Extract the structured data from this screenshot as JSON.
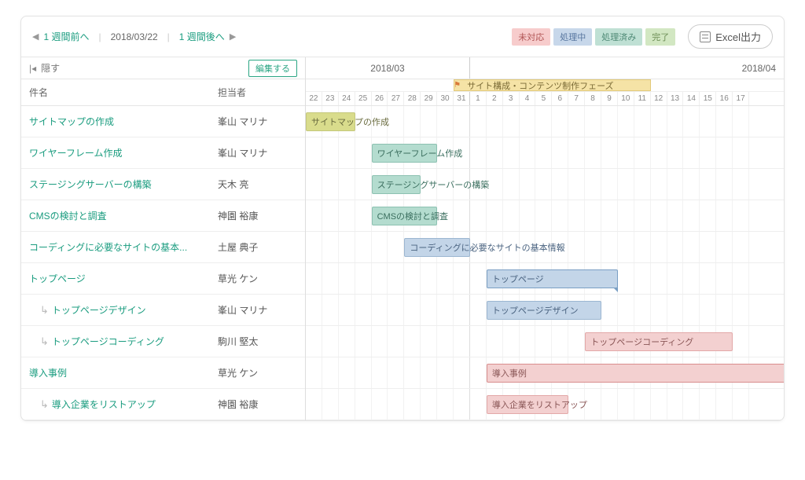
{
  "topbar": {
    "prev_label": "1 週間前へ",
    "date": "2018/03/22",
    "next_label": "1 週間後へ",
    "statuses": [
      {
        "label": "未対応",
        "cls": "chip-a"
      },
      {
        "label": "処理中",
        "cls": "chip-b"
      },
      {
        "label": "処理済み",
        "cls": "chip-c"
      },
      {
        "label": "完了",
        "cls": "chip-d"
      }
    ],
    "excel_label": "Excel出力"
  },
  "left": {
    "hide_label": "隠す",
    "edit_label": "編集する",
    "col_name": "件名",
    "col_assignee": "担当者"
  },
  "timeline": {
    "month1": "2018/03",
    "month2": "2018/04",
    "days": [
      "22",
      "23",
      "24",
      "25",
      "26",
      "27",
      "28",
      "29",
      "30",
      "31",
      "1",
      "2",
      "3",
      "4",
      "5",
      "6",
      "7",
      "8",
      "9",
      "10",
      "11",
      "12",
      "13",
      "14",
      "15",
      "16",
      "17"
    ],
    "month_sep_index": 9,
    "phase": {
      "label": "サイト構成・コンテンツ制作フェーズ",
      "start": 9,
      "len": 12
    }
  },
  "tasks": [
    {
      "name": "サイトマップの作成",
      "assignee": "峯山 マリナ",
      "indent": 0,
      "bar": {
        "label": "サイトマップの作成",
        "start": 0,
        "len": 3,
        "color": "olive"
      }
    },
    {
      "name": "ワイヤーフレーム作成",
      "assignee": "峯山 マリナ",
      "indent": 0,
      "bar": {
        "label": "ワイヤーフレーム作成",
        "start": 4,
        "len": 4,
        "color": "teal"
      }
    },
    {
      "name": "ステージングサーバーの構築",
      "assignee": "天木 亮",
      "indent": 0,
      "bar": {
        "label": "ステージングサーバーの構築",
        "start": 4,
        "len": 3,
        "color": "teal"
      }
    },
    {
      "name": "CMSの検討と調査",
      "assignee": "神園 裕康",
      "indent": 0,
      "bar": {
        "label": "CMSの検討と調査",
        "start": 4,
        "len": 4,
        "color": "teal"
      }
    },
    {
      "name": "コーディングに必要なサイトの基本...",
      "assignee": "土屋 典子",
      "indent": 0,
      "bar": {
        "label": "コーディングに必要なサイトの基本情報",
        "start": 6,
        "len": 4,
        "color": "blue"
      }
    },
    {
      "name": "トップページ",
      "assignee": "草光 ケン",
      "indent": 0,
      "bar": {
        "label": "トップページ",
        "start": 11,
        "len": 8,
        "color": "blue-header"
      }
    },
    {
      "name": "トップページデザイン",
      "assignee": "峯山 マリナ",
      "indent": 1,
      "bar": {
        "label": "トップページデザイン",
        "start": 11,
        "len": 7,
        "color": "blue"
      }
    },
    {
      "name": "トップページコーディング",
      "assignee": "駒川 堅太",
      "indent": 1,
      "bar": {
        "label": "トップページコーディング",
        "start": 17,
        "len": 9,
        "color": "pink"
      }
    },
    {
      "name": "導入事例",
      "assignee": "草光 ケン",
      "indent": 0,
      "bar": {
        "label": "導入事例",
        "start": 11,
        "len": 19,
        "color": "pink-header"
      }
    },
    {
      "name": "導入企業をリストアップ",
      "assignee": "神園 裕康",
      "indent": 1,
      "bar": {
        "label": "導入企業をリストアップ",
        "start": 11,
        "len": 5,
        "color": "pink"
      }
    }
  ],
  "chart_data": {
    "type": "gantt",
    "title": "",
    "x_unit": "day",
    "x_range": [
      "2018-03-22",
      "2018-04-17"
    ],
    "phase": {
      "name": "サイト構成・コンテンツ制作フェーズ",
      "start": "2018-03-31",
      "end": "2018-04-11"
    },
    "tasks": [
      {
        "name": "サイトマップの作成",
        "assignee": "峯山 マリナ",
        "start": "2018-03-22",
        "end": "2018-03-24",
        "status": "完了"
      },
      {
        "name": "ワイヤーフレーム作成",
        "assignee": "峯山 マリナ",
        "start": "2018-03-26",
        "end": "2018-03-29",
        "status": "処理済み"
      },
      {
        "name": "ステージングサーバーの構築",
        "assignee": "天木 亮",
        "start": "2018-03-26",
        "end": "2018-03-28",
        "status": "処理済み"
      },
      {
        "name": "CMSの検討と調査",
        "assignee": "神園 裕康",
        "start": "2018-03-26",
        "end": "2018-03-29",
        "status": "処理済み"
      },
      {
        "name": "コーディングに必要なサイトの基本情報",
        "assignee": "土屋 典子",
        "start": "2018-03-28",
        "end": "2018-03-31",
        "status": "処理中"
      },
      {
        "name": "トップページ",
        "assignee": "草光 ケン",
        "start": "2018-04-02",
        "end": "2018-04-09",
        "status": "処理中",
        "parent": true
      },
      {
        "name": "トップページデザイン",
        "assignee": "峯山 マリナ",
        "start": "2018-04-02",
        "end": "2018-04-08",
        "status": "処理中",
        "parent_of": "トップページ"
      },
      {
        "name": "トップページコーディング",
        "assignee": "駒川 堅太",
        "start": "2018-04-08",
        "end": "2018-04-16",
        "status": "未対応",
        "parent_of": "トップページ"
      },
      {
        "name": "導入事例",
        "assignee": "草光 ケン",
        "start": "2018-04-02",
        "end": "2018-04-21",
        "status": "未対応",
        "parent": true
      },
      {
        "name": "導入企業をリストアップ",
        "assignee": "神園 裕康",
        "start": "2018-04-02",
        "end": "2018-04-06",
        "status": "未対応",
        "parent_of": "導入事例"
      }
    ]
  }
}
